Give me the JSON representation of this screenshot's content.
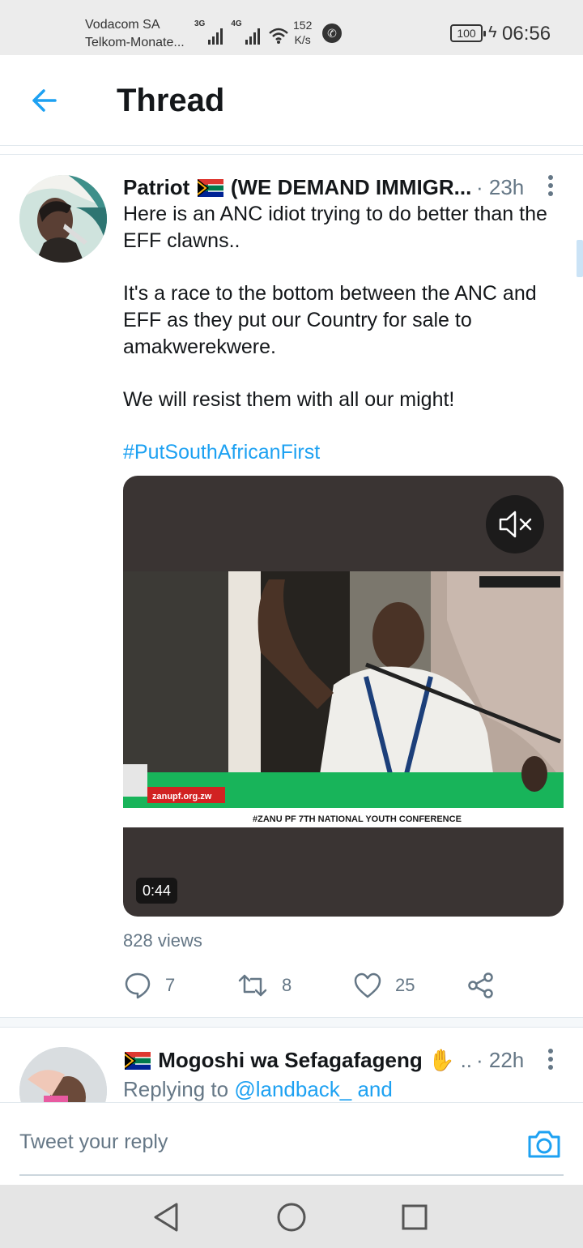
{
  "status_bar": {
    "carrier_1": "Vodacom SA",
    "carrier_2": "Telkom-Monate...",
    "net_1": "3G",
    "net_2": "4G",
    "speed_value": "152",
    "speed_unit": "K/s",
    "battery": "100",
    "time": "06:56"
  },
  "header": {
    "back_icon": "arrow-left-icon",
    "title": "Thread",
    "accent_color": "#1da1f2"
  },
  "tweet": {
    "author_name": "Patriot",
    "author_suffix": "(WE DEMAND IMMIGR...",
    "flag": "south-africa-flag",
    "time": "· 23h",
    "paragraphs": [
      "Here is an ANC idiot trying to do better than the EFF clawns..",
      "It's a race to the bottom between the ANC and EFF as they put our Country for sale to amakwerekwere.",
      "We will resist them with all our might!"
    ],
    "hashtag": "#PutSouthAfricanFirst",
    "video": {
      "duration": "0:44",
      "mute_icon": "speaker-muted-icon",
      "banner_site": "zanupf.org.zw",
      "ticker": "#ZANU PF 7TH NATIONAL YOUTH CONFERENCE"
    },
    "views": "828 views",
    "replies": "7",
    "retweets": "8",
    "likes": "25"
  },
  "tweet2": {
    "author_name": "Mogoshi wa Sefagafageng",
    "ellipsis": "...",
    "time": "· 22h",
    "replying_label": "Replying to",
    "replying_mention": "@landback_ and"
  },
  "composer": {
    "placeholder": "Tweet your reply",
    "camera_icon": "camera-icon"
  },
  "navbar": {
    "back": "triangle-back-icon",
    "home": "circle-home-icon",
    "recents": "square-recents-icon"
  }
}
